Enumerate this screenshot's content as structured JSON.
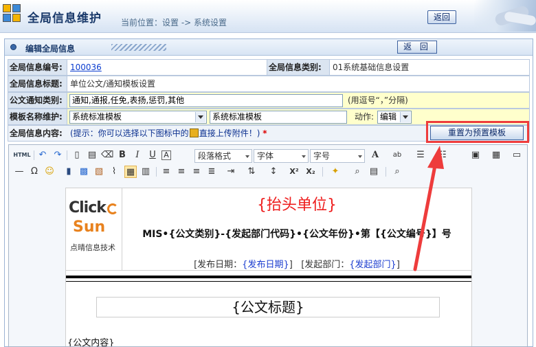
{
  "header": {
    "title": "全局信息维护",
    "location": "当前位置：设置 -> 系统设置",
    "back_label": "返回"
  },
  "panel": {
    "title": "编辑全局信息",
    "back_label": "返 回"
  },
  "form": {
    "id_label": "全局信息编号:",
    "id_value": "100036",
    "category_label": "全局信息类别:",
    "category_value": "01系统基础信息设置",
    "title_label": "全局信息标题:",
    "title_value": "单位公文/通知模板设置",
    "notice_label": "公文通知类别:",
    "notice_value": "通知,通报,任免,表扬,惩罚,其他",
    "notice_hint": "(用逗号“，”分隔)",
    "template_label": "模板名称维护:",
    "template_select": "系统标准模板",
    "template_name": "系统标准模板",
    "action_label": "动作:",
    "action_select": "编辑",
    "content_label": "全局信息内容:",
    "content_hint_prefix": "(提示：你可以选择以下图标中的",
    "content_hint_suffix": "直接上传附件！)",
    "required_mark": "*",
    "reset_label": "重置为预置模板"
  },
  "toolbar": {
    "html_label": "HTML",
    "paragraph": "段落格式",
    "font": "字体",
    "size": "字号"
  },
  "document": {
    "logo_top": "Click",
    "logo_bottom": "Sun",
    "logo_cn": "点晴信息技术",
    "red_header": "{抬头单位}",
    "code_line": "MIS•{公文类别}-{发起部门代码}•{公文年份}•第【{公文编号}】号",
    "date_label": "[发布日期：",
    "date_value": "{发布日期}",
    "date_close": "]",
    "dept_label": "[发起部门：",
    "dept_value": "{发起部门}",
    "dept_close": "]",
    "doc_title": "{公文标题}",
    "doc_body": "{公文内容}"
  },
  "colors": {
    "accent": "#1a3a6b",
    "highlight": "#ee3c3c",
    "label_bg": "#dbe5f1",
    "yellow_bg": "#ffffcc"
  }
}
